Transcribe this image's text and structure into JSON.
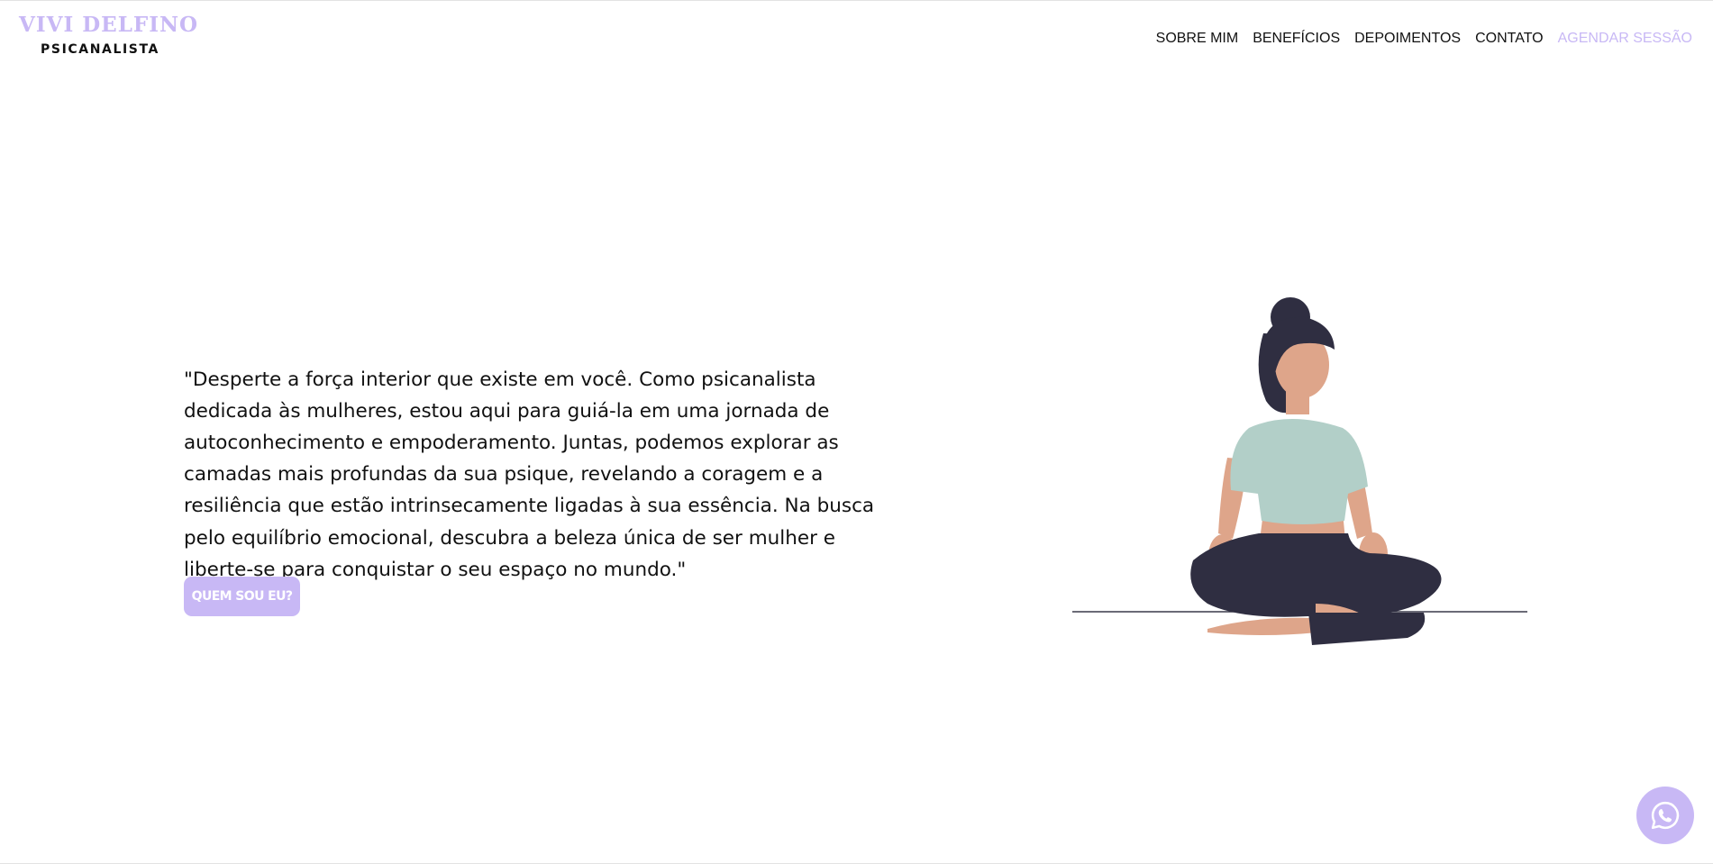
{
  "header": {
    "brand_name": "VIVI DELFINO",
    "brand_role": "PSICANALISTA",
    "nav": [
      {
        "label": "SOBRE MIM"
      },
      {
        "label": "BENEFÍCIOS"
      },
      {
        "label": "DEPOIMENTOS"
      },
      {
        "label": "CONTATO"
      },
      {
        "label": "AGENDAR SESSÃO"
      }
    ]
  },
  "hero": {
    "quote": "\"Desperte a força interior que existe em você. Como psicanalista dedicada às mulheres, estou aqui para guiá-la em uma jornada de autoconhecimento e empoderamento. Juntas, podemos explorar as camadas mais profundas da sua psique, revelando a coragem e a resiliência que estão intrinsecamente ligadas à sua essência. Na busca pelo equilíbrio emocional, descubra a beleza única de ser mulher e liberte-se para conquistar o seu espaço no mundo.\"",
    "cta_label": "QUEM SOU EU?"
  },
  "illustration": {
    "icon": "meditating-woman-illustration"
  },
  "floating_button": {
    "icon": "whatsapp-icon"
  },
  "colors": {
    "accent": "#c8b8f5",
    "text": "#111111",
    "hair": "#2f2e41",
    "skin": "#dea58a",
    "shirt": "#b2cfc8",
    "pants": "#2f2e41"
  }
}
